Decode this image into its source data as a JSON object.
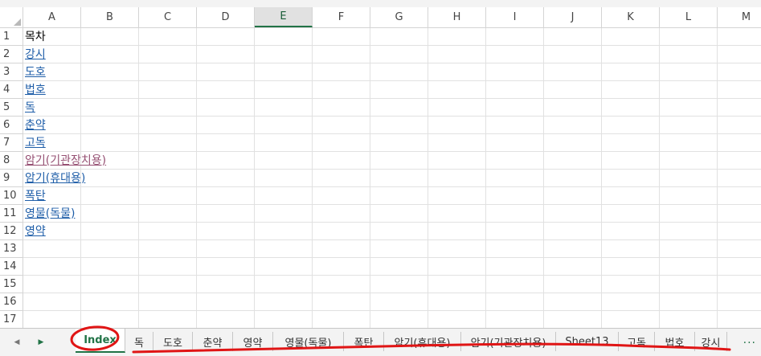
{
  "columns": [
    "A",
    "B",
    "C",
    "D",
    "E",
    "F",
    "G",
    "H",
    "I",
    "J",
    "K",
    "L",
    "M"
  ],
  "active_column": "E",
  "rows": [
    {
      "n": "1",
      "text": "목차",
      "style": "plain"
    },
    {
      "n": "2",
      "text": "강시",
      "style": "link"
    },
    {
      "n": "3",
      "text": "도호",
      "style": "link"
    },
    {
      "n": "4",
      "text": "법호",
      "style": "link"
    },
    {
      "n": "5",
      "text": "독",
      "style": "link"
    },
    {
      "n": "6",
      "text": "춘약",
      "style": "link"
    },
    {
      "n": "7",
      "text": "고독",
      "style": "link"
    },
    {
      "n": "8",
      "text": "암기(기관장치용)",
      "style": "visited"
    },
    {
      "n": "9",
      "text": "암기(휴대용)",
      "style": "link"
    },
    {
      "n": "10",
      "text": "폭탄",
      "style": "link"
    },
    {
      "n": "11",
      "text": "영물(독물)",
      "style": "link"
    },
    {
      "n": "12",
      "text": "영약",
      "style": "link"
    },
    {
      "n": "13",
      "text": "",
      "style": "plain"
    },
    {
      "n": "14",
      "text": "",
      "style": "plain"
    },
    {
      "n": "15",
      "text": "",
      "style": "plain"
    },
    {
      "n": "16",
      "text": "",
      "style": "plain"
    },
    {
      "n": "17",
      "text": "",
      "style": "plain"
    }
  ],
  "tabs": [
    {
      "label": "Index",
      "active": true
    },
    {
      "label": "독",
      "active": false
    },
    {
      "label": "도호",
      "active": false
    },
    {
      "label": "춘약",
      "active": false
    },
    {
      "label": "영약",
      "active": false
    },
    {
      "label": "영물(독물)",
      "active": false
    },
    {
      "label": "폭탄",
      "active": false
    },
    {
      "label": "암기(휴대용)",
      "active": false
    },
    {
      "label": "암기(기관장치용)",
      "active": false
    },
    {
      "label": "Sheet13",
      "active": false
    },
    {
      "label": "고독",
      "active": false
    },
    {
      "label": "법호",
      "active": false
    },
    {
      "label": "강시",
      "active": false
    }
  ],
  "more_tabs": "...",
  "icons": {
    "prev": "triangle-left-icon",
    "next": "triangle-right-icon"
  },
  "colors": {
    "accent": "#217346",
    "link": "#1f5ea8",
    "visited": "#954f72",
    "annotation": "#e01515"
  }
}
